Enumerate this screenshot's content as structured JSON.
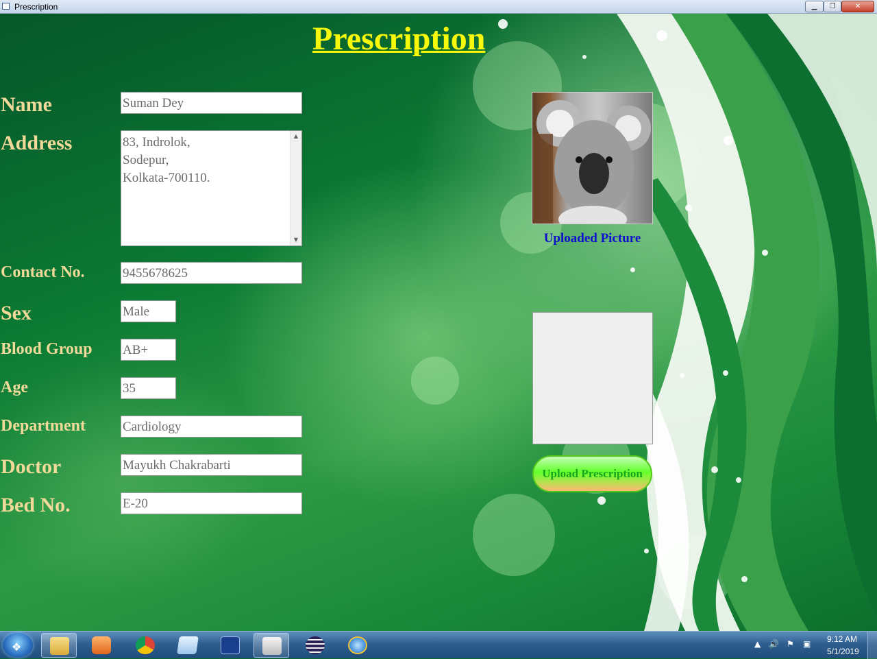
{
  "window": {
    "title": "Prescription",
    "controls": {
      "minimize": "minimize-icon",
      "maximize": "restore-icon",
      "close": "close-icon"
    }
  },
  "form": {
    "heading": "Prescription",
    "name": {
      "label": "Name",
      "value": "Suman Dey"
    },
    "address": {
      "label": "Address",
      "lines": [
        "83, Indrolok,",
        "Sodepur,",
        "Kolkata-700110."
      ]
    },
    "contact": {
      "label": "Contact No.",
      "value": "9455678625"
    },
    "sex": {
      "label": "Sex",
      "value": "Male"
    },
    "blood_group": {
      "label": "Blood Group",
      "value": "AB+"
    },
    "age": {
      "label": "Age",
      "value": "35"
    },
    "department": {
      "label": "Department",
      "value": "Cardiology"
    },
    "doctor": {
      "label": "Doctor",
      "value": "Mayukh Chakrabarti"
    },
    "bed": {
      "label": "Bed No.",
      "value": "E-20"
    }
  },
  "media": {
    "photo_caption": "Uploaded Picture",
    "upload_button": "Upload Prescription"
  },
  "taskbar": {
    "apps": [
      "start-icon",
      "file-explorer-icon",
      "media-player-icon",
      "chrome-icon",
      "notepad-icon",
      "devcpp-icon",
      "prescription-app-icon",
      "eclipse-icon",
      "internet-explorer-icon"
    ],
    "clock_time": "9:12 AM",
    "clock_date": "5/1/2019"
  },
  "colors": {
    "heading": "#f8f80a",
    "label": "#f1d99a",
    "caption": "#1010cc",
    "button_text": "#17a61d"
  }
}
